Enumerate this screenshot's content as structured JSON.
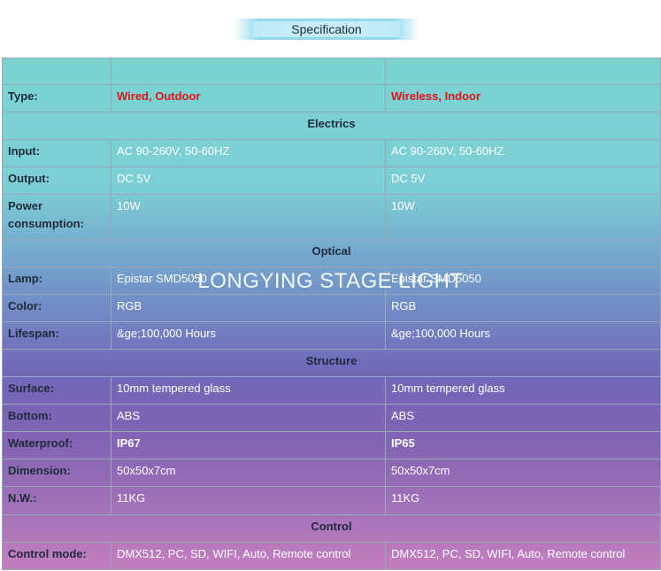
{
  "header": {
    "title": "Specification"
  },
  "watermark": "LONGYING STAGE LIGHT",
  "colors": {
    "type_value": "#e8101a",
    "label_text": "#1f2a3a",
    "value_text": "#ffffff"
  },
  "table": {
    "type": {
      "label": "Type:",
      "a": "Wired, Outdoor",
      "b": "Wireless, Indoor"
    },
    "electrics": "Electrics",
    "input": {
      "label": "Input:",
      "a": "AC 90-260V, 50-60HZ",
      "b": "AC 90-260V, 50-60HZ"
    },
    "output": {
      "label": "Output:",
      "a": "DC 5V",
      "b": "DC 5V"
    },
    "power": {
      "label_1": "Power",
      "label_2": "consumption:",
      "a": "10W",
      "b": "10W"
    },
    "optical": "Optical",
    "lamp": {
      "label": "Lamp:",
      "a": "Epistar SMD5050",
      "b": "Epistar SMD5050"
    },
    "color": {
      "label": "Color:",
      "a": "RGB",
      "b": "RGB"
    },
    "lifespan": {
      "label": "Lifespan:",
      "a": "&ge;100,000 Hours",
      "b": "&ge;100,000 Hours"
    },
    "structure": "Structure",
    "surface": {
      "label": "Surface:",
      "a": "10mm tempered glass",
      "b": "10mm tempered glass"
    },
    "bottom": {
      "label": "Bottom:",
      "a": "ABS",
      "b": "ABS"
    },
    "waterproof": {
      "label": "Waterproof:",
      "a": "IP67",
      "b": "IP65"
    },
    "dimension": {
      "label": "Dimension:",
      "a": "50x50x7cm",
      "b": "50x50x7cm"
    },
    "nw": {
      "label": "N.W.:",
      "a": "11KG",
      "b": "11KG"
    },
    "control": "Control",
    "control_mode": {
      "label": "Control mode:",
      "a": "DMX512, PC, SD, WIFI, Auto, Remote control",
      "b": "DMX512, PC, SD, WIFI, Auto, Remote control"
    }
  }
}
